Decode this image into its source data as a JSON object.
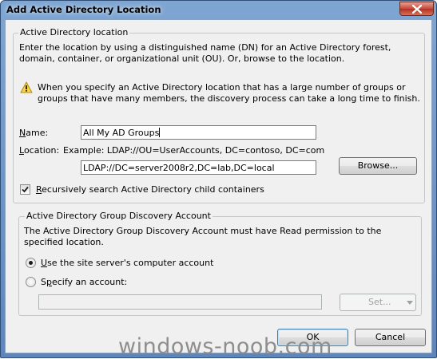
{
  "window": {
    "title": "Add Active Directory Location",
    "close_icon": "close-icon"
  },
  "location_group": {
    "legend": "Active Directory location",
    "description": "Enter the location by using a distinguished name (DN) for an Active Directory forest, domain, container, or organizational unit (OU). Or, browse to the location.",
    "warning_icon": "warning-icon",
    "warning_text": "When you specify an Active Directory location that has a large number of groups or groups that have many members, the discovery process can take a long time to finish.",
    "name_label": "Name:",
    "name_value": "All My AD Groups",
    "location_label": "Location:",
    "location_example": "Example: LDAP://OU=UserAccounts, DC=contoso, DC=com",
    "location_value": "LDAP://DC=server2008r2,DC=lab,DC=local",
    "browse_label": "Browse...",
    "recursive_label": "Recursively search Active Directory child containers",
    "recursive_checked": true
  },
  "account_group": {
    "legend": "Active Directory Group Discovery Account",
    "description": "The Active Directory Group Discovery Account must have Read permission to the specified location.",
    "option_site": "Use the site server's computer account",
    "option_specify": "Specify an account:",
    "selected": "site",
    "account_value": "",
    "set_label": "Set..."
  },
  "footer": {
    "ok_label": "OK",
    "cancel_label": "Cancel"
  },
  "watermark": "windows-noob.com"
}
